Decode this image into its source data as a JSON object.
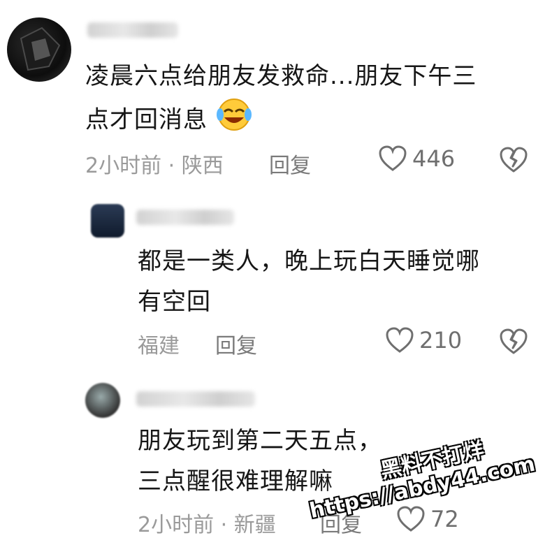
{
  "comments": [
    {
      "text_line1": "凌晨六点给朋友发救命...朋友下午三",
      "text_line2": "点才回消息",
      "emoji": "laughing-crying-emoji",
      "meta": "2小时前 · 陕西",
      "reply_label": "回复",
      "likes": "446"
    },
    {
      "text_line1": "都是一类人，晚上玩白天睡觉哪",
      "text_line2": "有空回",
      "meta": "福建",
      "reply_label": "回复",
      "likes": "210"
    },
    {
      "text_line1": "朋友玩到第二天五点，",
      "text_line2": "三点醒很难理解嘛",
      "meta": "2小时前 · 新疆",
      "reply_label": "回复",
      "likes": "72"
    }
  ],
  "watermark": {
    "line1": "黑料不打烊",
    "line2": "https://abdy44.com"
  },
  "icons": {
    "like": "heart-outline-icon",
    "dislike": "broken-heart-icon"
  },
  "colors": {
    "background": "#ffffff",
    "text": "#161616",
    "meta": "#9a9a9a",
    "icon": "#6f6f6f"
  }
}
